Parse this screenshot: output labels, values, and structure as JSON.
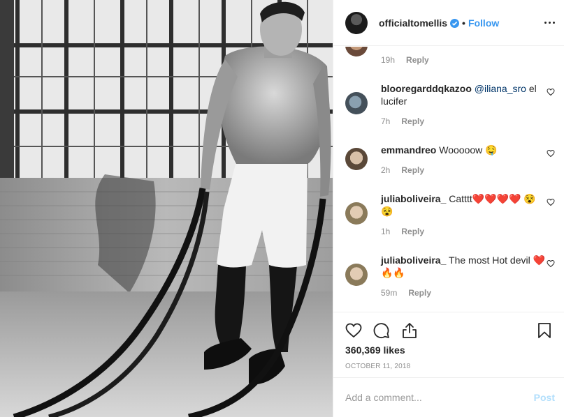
{
  "header": {
    "username": "officialtomellis",
    "separator": "•",
    "follow_label": "Follow",
    "verified_icon": "verified-badge-icon",
    "more_icon": "more-options-icon"
  },
  "comments": [
    {
      "user": "",
      "text": "",
      "time": "19h",
      "reply": "Reply",
      "partial": true
    },
    {
      "user": "blooregarddqkazoo",
      "mention": "@iliana_sro",
      "text": " el lucifer",
      "time": "7h",
      "reply": "Reply"
    },
    {
      "user": "emmandreo",
      "text": "Wooooow 🤤",
      "time": "2h",
      "reply": "Reply"
    },
    {
      "user": "juliaboliveira_",
      "text": "Catttt❤️❤️❤️❤️ 😵😵",
      "time": "1h",
      "reply": "Reply"
    },
    {
      "user": "juliaboliveira_",
      "text": "The most Hot devil ❤️🔥🔥",
      "time": "59m",
      "reply": "Reply"
    }
  ],
  "actions": {
    "like_icon": "heart-icon",
    "comment_icon": "comment-icon",
    "share_icon": "share-icon",
    "save_icon": "bookmark-icon"
  },
  "likes": "360,369 likes",
  "date": "OCTOBER 11, 2018",
  "add_comment": {
    "placeholder": "Add a comment...",
    "post_label": "Post"
  },
  "colors": {
    "link_blue": "#3897f0",
    "post_disabled": "#b2dffc",
    "mention": "#003569",
    "meta_gray": "#8e8e8e"
  }
}
